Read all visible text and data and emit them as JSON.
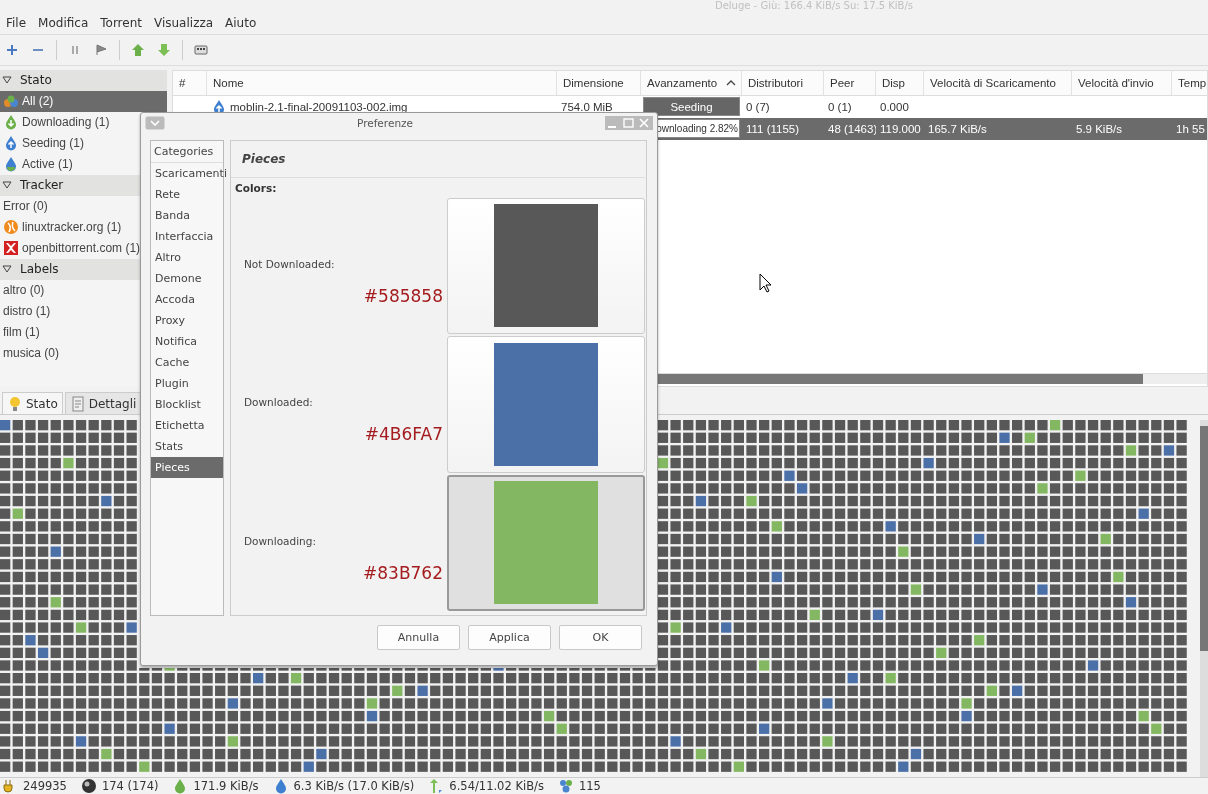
{
  "window": {
    "title": "Deluge - Giù: 166.4 KiB/s Su: 17.5 KiB/s"
  },
  "menu": [
    "File",
    "Modifica",
    "Torrent",
    "Visualizza",
    "Aiuto"
  ],
  "toolbar": [
    {
      "kind": "add"
    },
    {
      "kind": "remove"
    },
    {
      "kind": "sep"
    },
    {
      "kind": "pause"
    },
    {
      "kind": "resume"
    },
    {
      "kind": "sep"
    },
    {
      "kind": "up"
    },
    {
      "kind": "down"
    },
    {
      "kind": "sep"
    },
    {
      "kind": "prefs"
    }
  ],
  "sidebar": [
    {
      "title": "Stato",
      "expanded": true,
      "items": [
        {
          "label": "All (2)",
          "kind": "all",
          "selected": true
        },
        {
          "label": "Downloading (1)",
          "kind": "downloading",
          "selected": false
        },
        {
          "label": "Seeding (1)",
          "kind": "seeding",
          "selected": false
        },
        {
          "label": "Active (1)",
          "kind": "active",
          "selected": false
        }
      ]
    },
    {
      "title": "Tracker",
      "expanded": true,
      "items": [
        {
          "label": "Error (0)",
          "kind": "plain",
          "selected": false
        },
        {
          "label": "linuxtracker.org (1)",
          "kind": "globe",
          "selected": false
        },
        {
          "label": "openbittorrent.com (1)",
          "kind": "tile",
          "selected": false
        }
      ]
    },
    {
      "title": "Labels",
      "expanded": true,
      "items": [
        {
          "label": "altro (0)",
          "kind": "plain",
          "selected": false
        },
        {
          "label": "distro (1)",
          "kind": "plain",
          "selected": false
        },
        {
          "label": "film (1)",
          "kind": "plain",
          "selected": false
        },
        {
          "label": "musica (0)",
          "kind": "plain",
          "selected": false
        }
      ]
    }
  ],
  "table": {
    "columns": [
      {
        "label": "#",
        "sorted": false
      },
      {
        "label": "Nome",
        "sorted": false
      },
      {
        "label": "Dimensione",
        "sorted": false
      },
      {
        "label": "Avanzamento",
        "sorted": true
      },
      {
        "label": "Distributori",
        "sorted": false
      },
      {
        "label": "Peer",
        "sorted": false
      },
      {
        "label": "Disp",
        "sorted": false
      },
      {
        "label": "Velocità di Scaricamento",
        "sorted": false
      },
      {
        "label": "Velocità d'invio",
        "sorted": false
      },
      {
        "label": "Temp",
        "sorted": false
      }
    ],
    "rows": [
      {
        "selected": false,
        "kind": "seeding",
        "name": "moblin-2.1-final-20091103-002.img",
        "size": "754.0 MiB",
        "progress": {
          "text": "Seeding",
          "level": 1
        },
        "seeds": "0 (7)",
        "peers": "0 (1)",
        "avail": "0.000"
      },
      {
        "selected": true,
        "progress": {
          "text": "ownloading 2.82%",
          "level": 0.0282
        },
        "seeds": "111 (1155)",
        "peers": "48 (1463)",
        "avail": "119.000",
        "down": "165.7 KiB/s",
        "up": "5.9 KiB/s",
        "eta": "1h 55"
      }
    ]
  },
  "bottom_tabs": [
    {
      "label": "Stato",
      "kind": "bulb",
      "selected": true
    },
    {
      "label": "Dettagli",
      "kind": "doc",
      "selected": false
    }
  ],
  "status_bar": [
    {
      "kind": "plug",
      "text": "249935"
    },
    {
      "kind": "sphere",
      "text": "174 (174)"
    },
    {
      "kind": "download",
      "text": "171.9 KiB/s"
    },
    {
      "kind": "upload",
      "text": "6.3 KiB/s (17.0 KiB/s)"
    },
    {
      "kind": "updown",
      "text": "6.54/11.02 KiB/s"
    },
    {
      "kind": "people",
      "text": "115"
    }
  ],
  "dialog": {
    "title": "Preferenze",
    "categories_header": "Categories",
    "categories": [
      {
        "label": "Scaricamenti",
        "selected": false
      },
      {
        "label": "Rete",
        "selected": false
      },
      {
        "label": "Banda",
        "selected": false
      },
      {
        "label": "Interfaccia",
        "selected": false
      },
      {
        "label": "Altro",
        "selected": false
      },
      {
        "label": "Demone",
        "selected": false
      },
      {
        "label": "Accoda",
        "selected": false
      },
      {
        "label": "Proxy",
        "selected": false
      },
      {
        "label": "Notifica",
        "selected": false
      },
      {
        "label": "Cache",
        "selected": false
      },
      {
        "label": "Plugin",
        "selected": false
      },
      {
        "label": "Blocklist",
        "selected": false
      },
      {
        "label": "Etichetta",
        "selected": false
      },
      {
        "label": "Stats",
        "selected": false
      },
      {
        "label": "Pieces",
        "selected": true
      }
    ],
    "page_title": "Pieces",
    "section_label": "Colors:",
    "colors": [
      {
        "label": "Not Downloaded:",
        "hex": "#585858",
        "color": "#585858",
        "pressed": false
      },
      {
        "label": "Downloaded:",
        "hex": "#4B6FA7",
        "color": "#4b6fa7",
        "pressed": false
      },
      {
        "label": "Downloading:",
        "hex": "#83B762",
        "color": "#83b762",
        "pressed": true
      }
    ],
    "buttons": [
      "Annulla",
      "Applica",
      "OK"
    ]
  }
}
